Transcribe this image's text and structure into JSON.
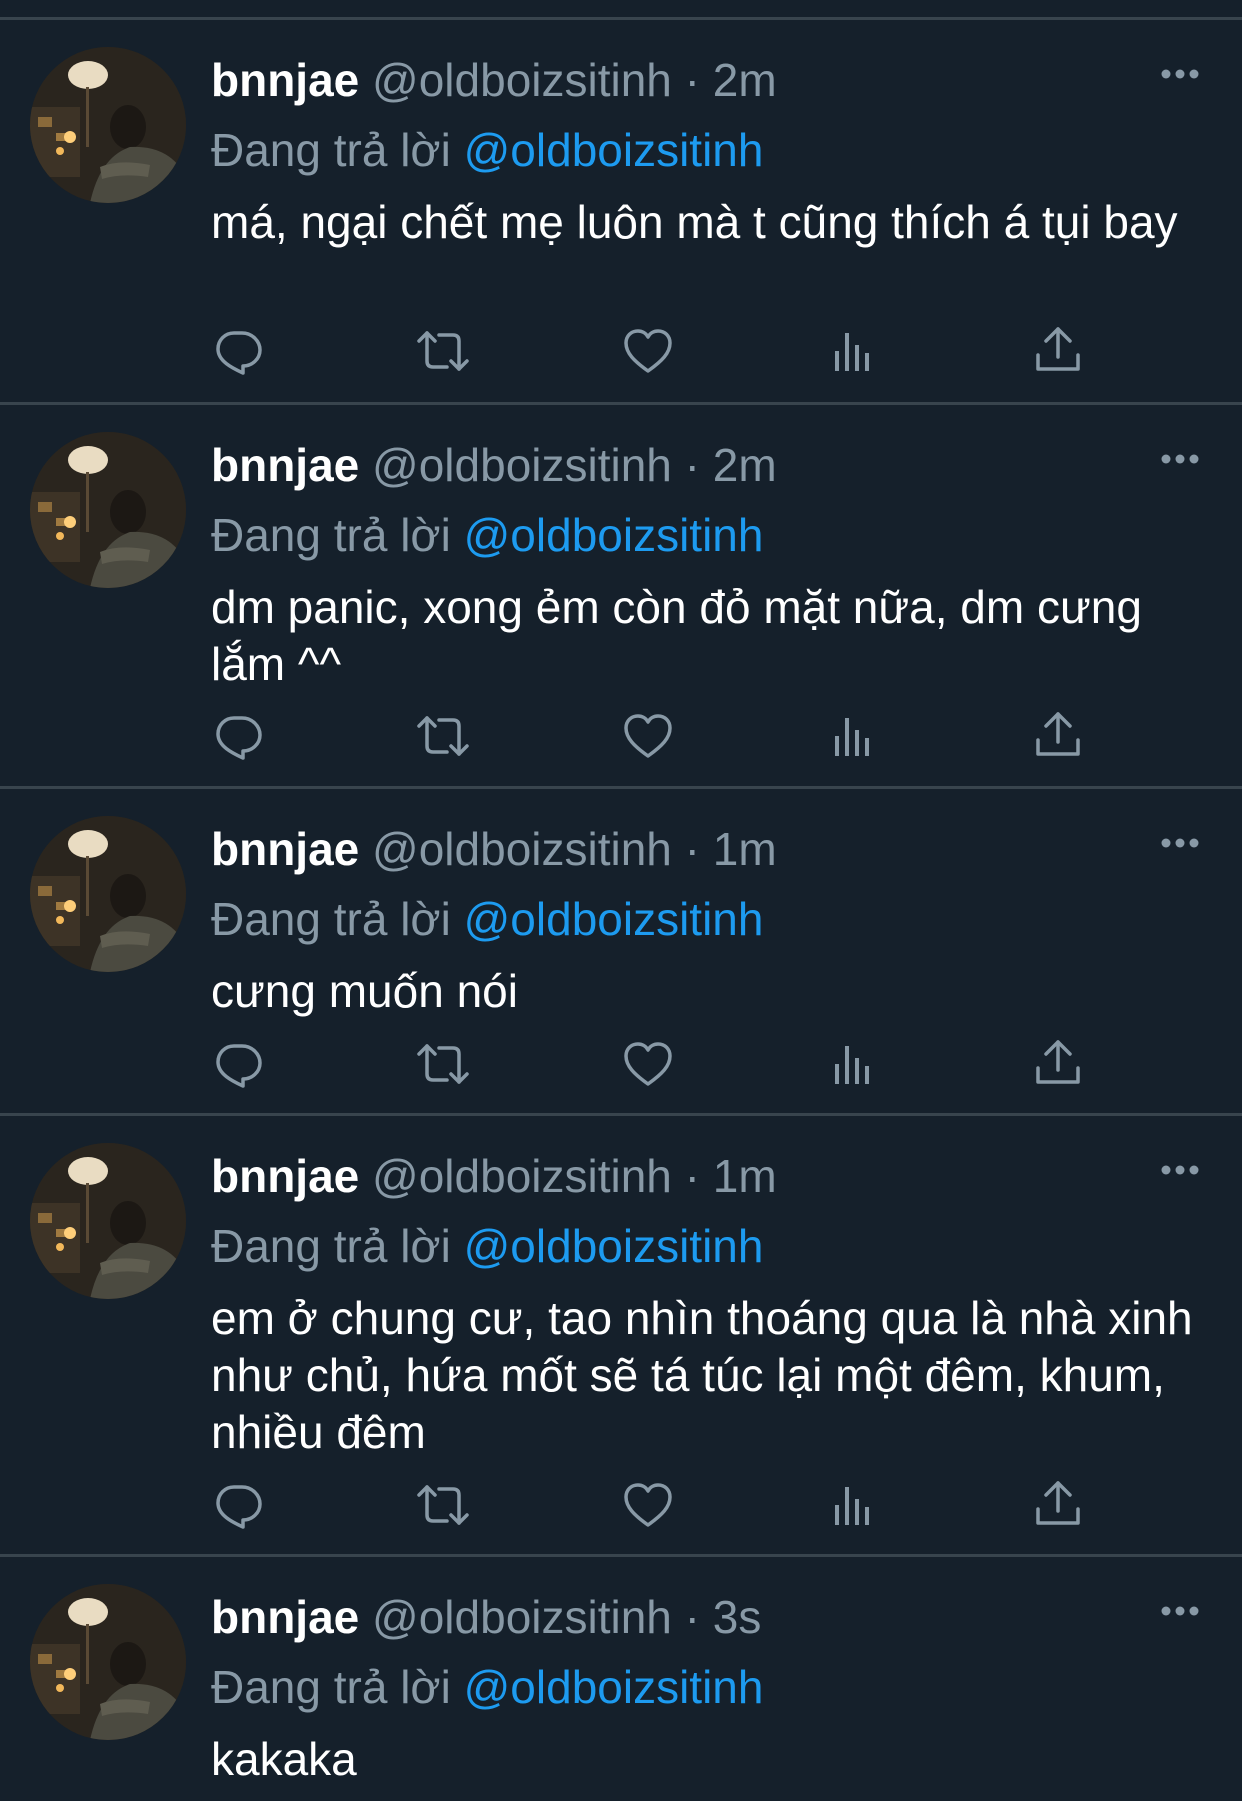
{
  "tweets": [
    {
      "name": "bnnjae",
      "handle": "@oldboizsitinh",
      "separator": "·",
      "time": "2m",
      "reply_label": "Đang trả lời",
      "reply_mention": "@oldboizsitinh",
      "text": "má, ngại chết mẹ luôn mà t cũng thích á tụi bay"
    },
    {
      "name": "bnnjae",
      "handle": "@oldboizsitinh",
      "separator": "·",
      "time": "2m",
      "reply_label": "Đang trả lời",
      "reply_mention": "@oldboizsitinh",
      "text": "dm panic, xong ẻm còn đỏ mặt nữa, dm cưng lắm ^^"
    },
    {
      "name": "bnnjae",
      "handle": "@oldboizsitinh",
      "separator": "·",
      "time": "1m",
      "reply_label": "Đang trả lời",
      "reply_mention": "@oldboizsitinh",
      "text": "cưng muốn nói"
    },
    {
      "name": "bnnjae",
      "handle": "@oldboizsitinh",
      "separator": "·",
      "time": "1m",
      "reply_label": "Đang trả lời",
      "reply_mention": "@oldboizsitinh",
      "text": "em ở chung cư, tao nhìn thoáng qua là nhà xinh như chủ, hứa mốt sẽ tá túc lại một đêm, khum, nhiều đêm"
    },
    {
      "name": "bnnjae",
      "handle": "@oldboizsitinh",
      "separator": "·",
      "time": "3s",
      "reply_label": "Đang trả lời",
      "reply_mention": "@oldboizsitinh",
      "text": "kakaka"
    }
  ],
  "icons": [
    "avatar-photo",
    "more-icon",
    "reply-icon",
    "retweet-icon",
    "like-icon",
    "views-icon",
    "share-icon"
  ],
  "colors": {
    "background": "#15202b",
    "divider": "#38444d",
    "primary_text": "#ffffff",
    "secondary_text": "#8899a6",
    "mention": "#1d9bf0"
  }
}
